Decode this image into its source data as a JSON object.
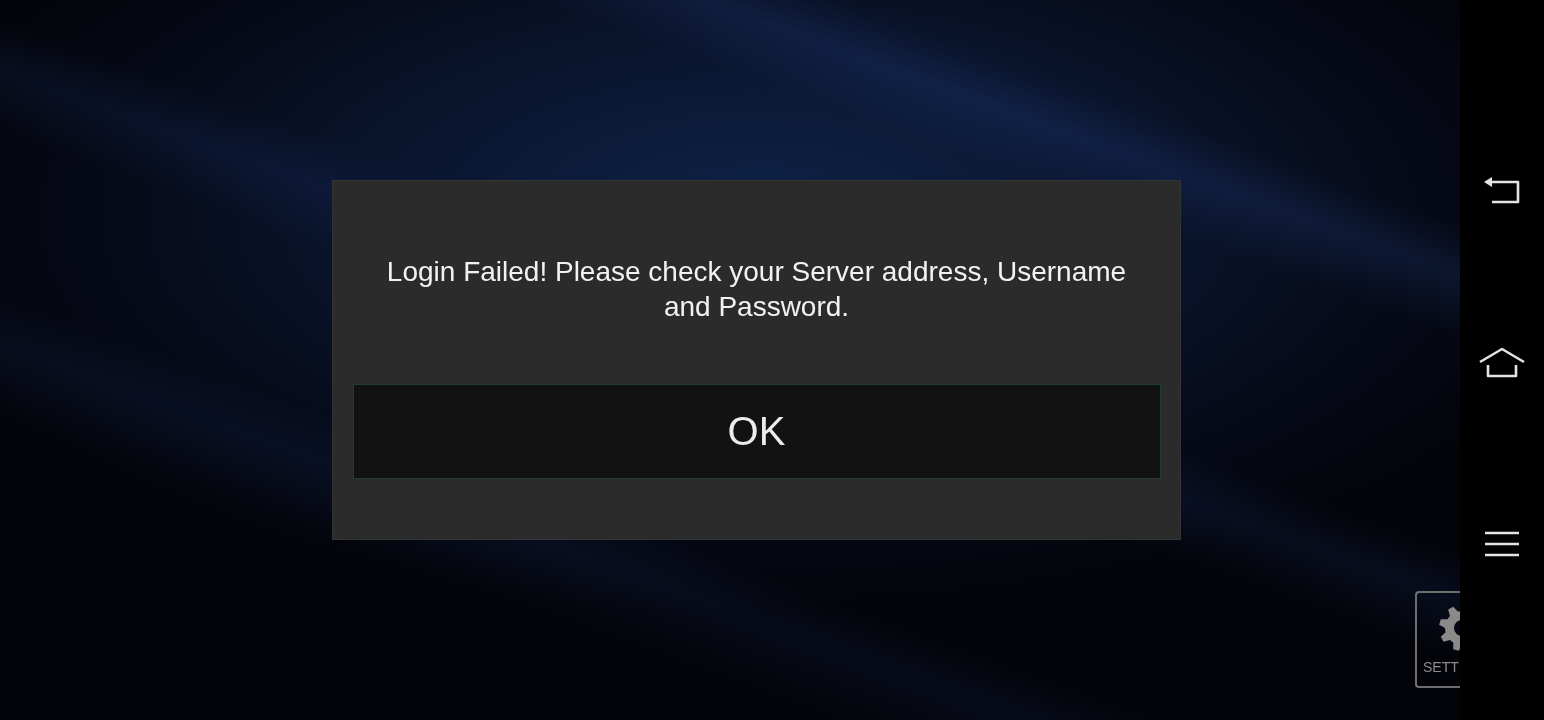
{
  "dialog": {
    "message": "Login Failed! Please check your Server address, Username and Password.",
    "button": "OK"
  },
  "settings_button": {
    "label": "SETT"
  },
  "nav_bar": {
    "buttons": [
      {
        "kind": "back"
      },
      {
        "kind": "home"
      },
      {
        "kind": "menu"
      }
    ]
  }
}
